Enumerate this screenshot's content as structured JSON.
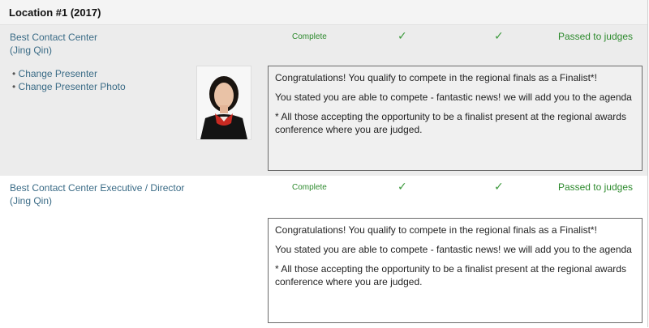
{
  "location": {
    "title": "Location #1 (2017)"
  },
  "entries": [
    {
      "category": "Best Contact Center",
      "presenter": "(Jing Qin)",
      "status": "Complete",
      "passed": "Passed to judges",
      "actions": [
        "Change Presenter",
        "Change Presenter Photo"
      ],
      "message": {
        "line1": "Congratulations! You qualify to compete in the regional finals as a Finalist*!",
        "line2": "You stated you are able to compete - fantastic news! we will add you to the agenda",
        "line3": "* All those accepting the opportunity to be a finalist present at the regional awards conference where you are judged."
      }
    },
    {
      "category": "Best Contact Center Executive / Director",
      "presenter": "(Jing Qin)",
      "status": "Complete",
      "passed": "Passed to judges",
      "message": {
        "line1": "Congratulations! You qualify to compete in the regional finals as a Finalist*!",
        "line2": "You stated you are able to compete - fantastic news! we will add you to the agenda",
        "line3": "* All those accepting the opportunity to be a finalist present at the regional awards conference where you are judged."
      }
    }
  ],
  "icons": {
    "check": "checkmark-icon",
    "photo": "presenter-photo"
  },
  "colors": {
    "link": "#3a6b86",
    "success": "#2d8a2d",
    "shaded": "#ececec"
  }
}
